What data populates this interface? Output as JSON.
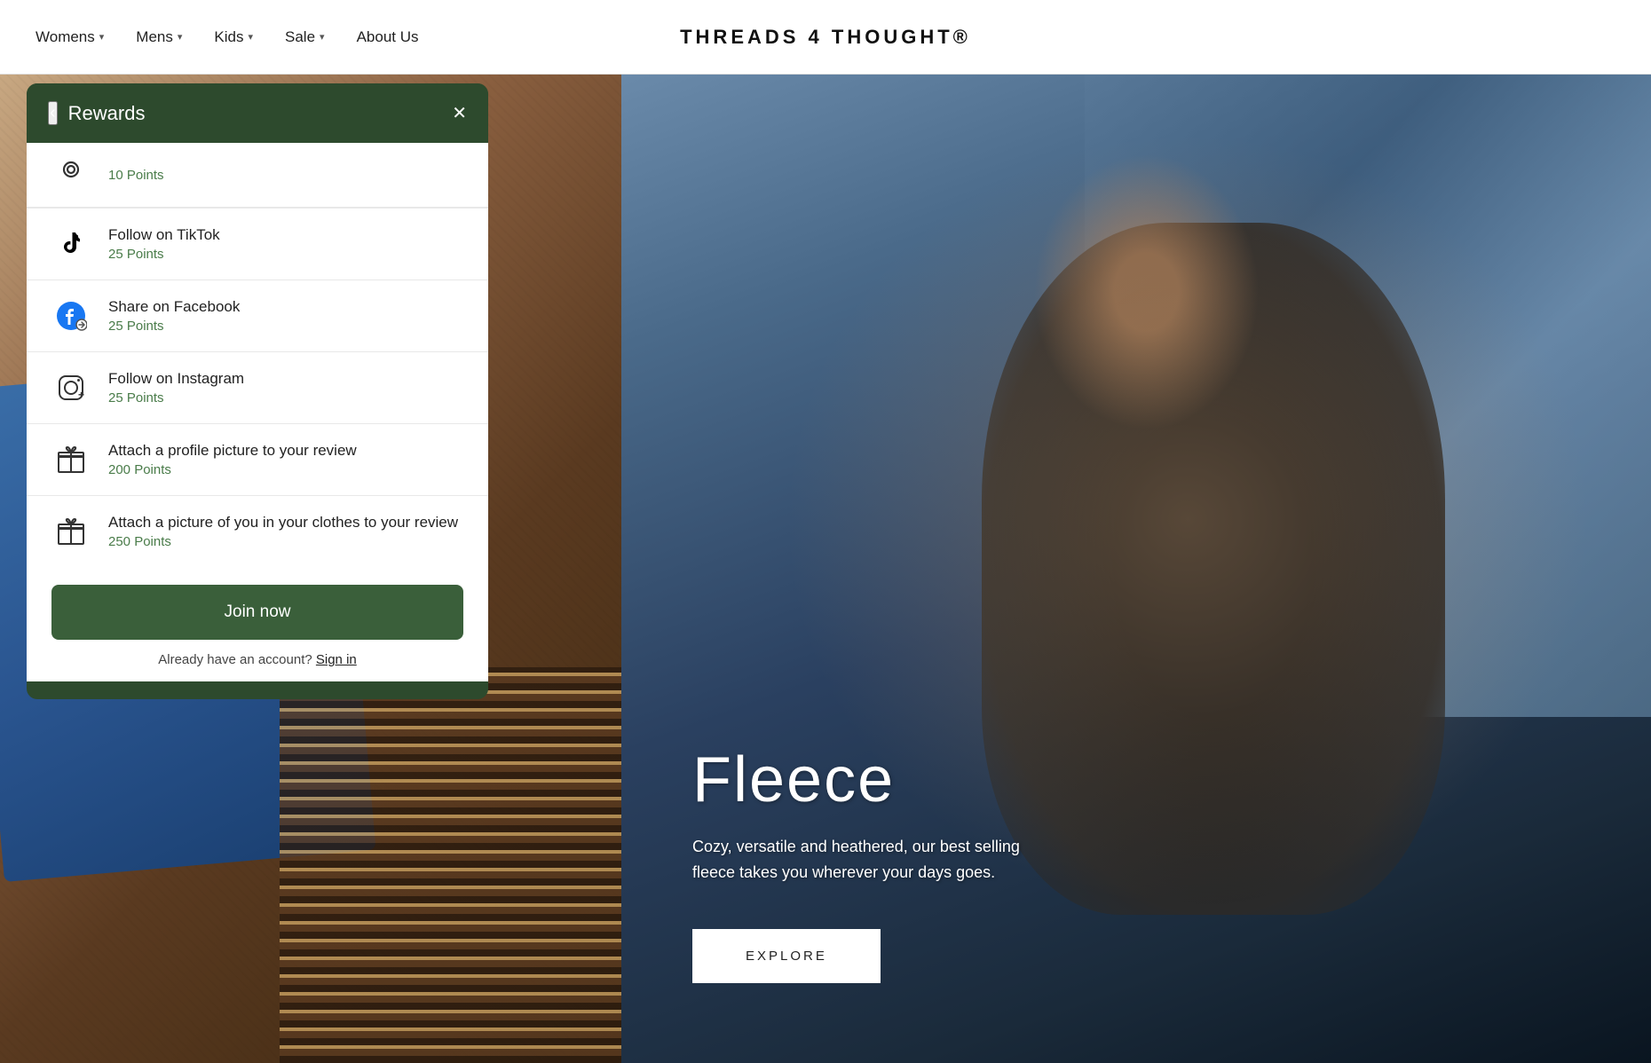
{
  "brand": {
    "name": "THREADS 4 THOUGHT®"
  },
  "nav": {
    "items": [
      {
        "label": "Womens",
        "has_dropdown": true
      },
      {
        "label": "Mens",
        "has_dropdown": true
      },
      {
        "label": "Kids",
        "has_dropdown": true
      },
      {
        "label": "Sale",
        "has_dropdown": true
      },
      {
        "label": "About Us",
        "has_dropdown": false
      }
    ]
  },
  "rewards_panel": {
    "title": "Rewards",
    "back_label": "‹",
    "close_label": "✕",
    "partial_item": {
      "points": "10 Points"
    },
    "items": [
      {
        "id": "tiktok",
        "name": "Follow on TikTok",
        "points": "25 Points",
        "icon": "tiktok"
      },
      {
        "id": "facebook",
        "name": "Share on Facebook",
        "points": "25 Points",
        "icon": "facebook"
      },
      {
        "id": "instagram",
        "name": "Follow on Instagram",
        "points": "25 Points",
        "icon": "instagram"
      },
      {
        "id": "profile-pic",
        "name": "Attach a profile picture to your review",
        "points": "200 Points",
        "icon": "gift"
      },
      {
        "id": "clothes-pic",
        "name": "Attach a picture of you in your clothes to your review",
        "points": "250 Points",
        "icon": "gift"
      }
    ],
    "join_button": "Join now",
    "signin_text": "Already have an account?",
    "signin_link": "Sign in"
  },
  "hero": {
    "title": "Fleece",
    "description": "Cozy, versatile and heathered, our best selling fleece takes you wherever your days goes.",
    "explore_button": "EXPLORE"
  }
}
